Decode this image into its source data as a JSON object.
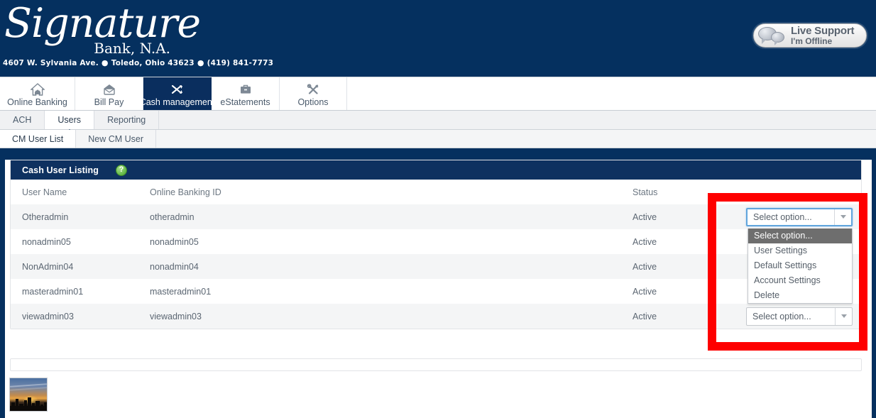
{
  "brand": {
    "script_name": "Signature",
    "sub_name": "Bank, N.A.",
    "address": "4607 W. Sylvania Ave.",
    "city": "Toledo, Ohio 43623",
    "phone": "(419) 841-7773",
    "separator": "●",
    "navy": "#05305f"
  },
  "live_support": {
    "title": "Live Support",
    "status": "I'm Offline"
  },
  "nav": {
    "main_tabs": [
      {
        "label": "Online Banking",
        "icon": "home-icon",
        "active": false
      },
      {
        "label": "Bill Pay",
        "icon": "envelope-icon",
        "active": false
      },
      {
        "label": "Cash management",
        "icon": "shuffle-icon",
        "active": true
      },
      {
        "label": "eStatements",
        "icon": "briefcase-icon",
        "active": false
      },
      {
        "label": "Options",
        "icon": "tools-icon",
        "active": false
      }
    ],
    "sub_tabs": [
      {
        "label": "ACH",
        "active": false
      },
      {
        "label": "Users",
        "active": true
      },
      {
        "label": "Reporting",
        "active": false
      }
    ],
    "third_tabs": [
      {
        "label": "CM User List",
        "active": true
      },
      {
        "label": "New CM User",
        "active": false
      }
    ]
  },
  "panel": {
    "title": "Cash User Listing",
    "help_glyph": "?"
  },
  "table": {
    "columns": [
      "User Name",
      "Online Banking ID",
      "Status",
      ""
    ],
    "rows": [
      {
        "user_name": "Otheradmin",
        "online_banking_id": "otheradmin",
        "status": "Active"
      },
      {
        "user_name": "nonadmin05",
        "online_banking_id": "nonadmin05",
        "status": "Active"
      },
      {
        "user_name": "NonAdmin04",
        "online_banking_id": "nonadmin04",
        "status": "Active"
      },
      {
        "user_name": "masteradmin01",
        "online_banking_id": "masteradmin01",
        "status": "Active"
      },
      {
        "user_name": "viewadmin03",
        "online_banking_id": "viewadmin03",
        "status": "Active"
      }
    ]
  },
  "select": {
    "value": "Select option...",
    "options": [
      "Select option...",
      "User Settings",
      "Default Settings",
      "Account Settings",
      "Delete"
    ],
    "selected_index": 0,
    "open_row_index": 0,
    "focus_color": "#60a5dd",
    "highlight_color": "#6e6e6e"
  },
  "annotation": {
    "color": "#fe0000",
    "shape": "rectangle"
  },
  "thumbnail": {
    "name": "city-skyline-sunset"
  }
}
